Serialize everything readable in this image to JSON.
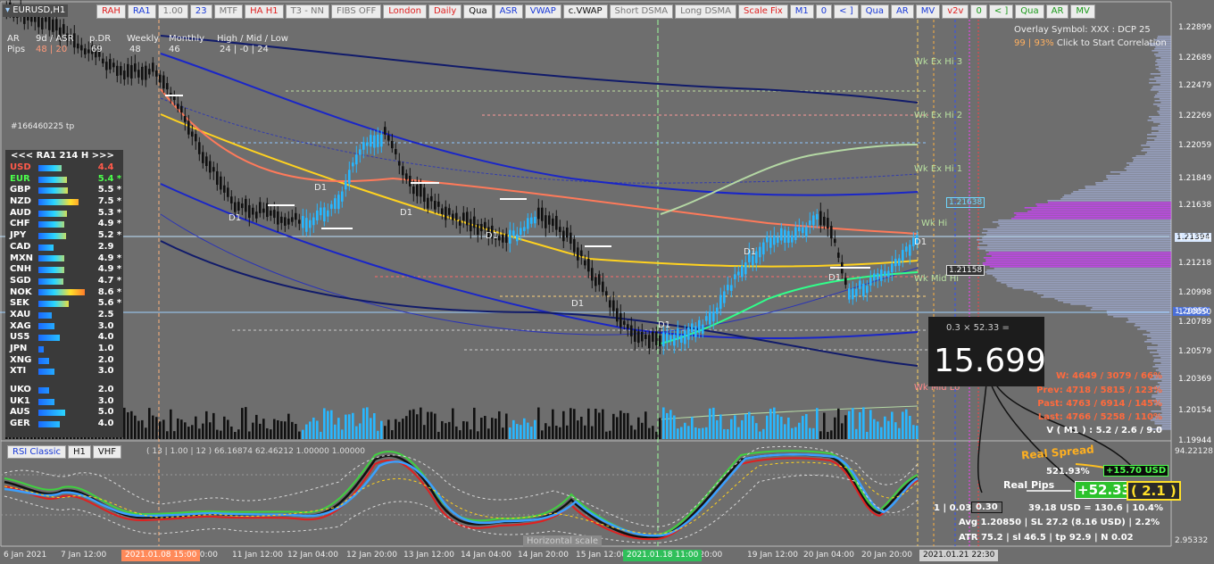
{
  "symbol": "EURUSD,H1",
  "toolbar": [
    "RAH",
    "RA1",
    "1.00",
    "23",
    "MTF",
    "HA H1",
    "T3 - NN",
    "FIBS OFF",
    "London",
    "Daily",
    "Qua",
    "ASR",
    "VWAP",
    "c.VWAP",
    "Short DSMA",
    "Long DSMA",
    "Scale Fix",
    "M1",
    "0",
    "< ]",
    "Qua",
    "AR",
    "MV",
    "v2v",
    "0",
    "< ]",
    "Qua",
    "AR",
    "MV"
  ],
  "toolbar_colors": [
    "#e02020",
    "#1a3ad8",
    "#777777",
    "#1a3ad8",
    "#777777",
    "#e02020",
    "#777777",
    "#777777",
    "#e02020",
    "#e02020",
    "#111111",
    "#1a3ad8",
    "#1a3ad8",
    "#111111",
    "#777777",
    "#777777",
    "#e02020",
    "#1a3ad8",
    "#1a3ad8",
    "#1a3ad8",
    "#1a3ad8",
    "#1a3ad8",
    "#1a3ad8",
    "#e02020",
    "#1a9a1a",
    "#1a9a1a",
    "#1a9a1a",
    "#1a9a1a",
    "#1a9a1a"
  ],
  "header_stats": {
    "ar_label": "AR",
    "pips_label": "Pips",
    "col_9d": "9d / ASR",
    "col_pdr": "p.DR",
    "col_weekly": "Weekly",
    "col_monthly": "Monthly",
    "col_hml": "High / Mid / Low",
    "val_9d": "48 | 20",
    "val_pdr": "69",
    "val_weekly": "48",
    "val_monthly": "46",
    "val_hml": "24 | -0 | 24"
  },
  "order_ref": "#166460225 tp",
  "overlay": {
    "line1": "Overlay Symbol: XXX : DCP 25",
    "line2_pct": "99 | 93%",
    "line2_text": " Click to Start Correlation"
  },
  "strength_panel": {
    "header": "<<<   RA1  214  H   >>>",
    "rows": [
      {
        "sym": "USD",
        "val": "4.4",
        "color": "#ff5a4a",
        "pct": 0.44
      },
      {
        "sym": "EUR",
        "val": "5.4 *",
        "color": "#4cff4c",
        "pct": 0.54
      },
      {
        "sym": "GBP",
        "val": "5.5 *",
        "color": "#ffffff",
        "pct": 0.55
      },
      {
        "sym": "NZD",
        "val": "7.5 *",
        "color": "#ffffff",
        "pct": 0.75
      },
      {
        "sym": "AUD",
        "val": "5.3 *",
        "color": "#ffffff",
        "pct": 0.53
      },
      {
        "sym": "CHF",
        "val": "4.9 *",
        "color": "#ffffff",
        "pct": 0.49
      },
      {
        "sym": "JPY",
        "val": "5.2 *",
        "color": "#ffffff",
        "pct": 0.52
      },
      {
        "sym": "CAD",
        "val": "2.9",
        "color": "#ffffff",
        "pct": 0.29
      },
      {
        "sym": "MXN",
        "val": "4.9 *",
        "color": "#ffffff",
        "pct": 0.49
      },
      {
        "sym": "CNH",
        "val": "4.9 *",
        "color": "#ffffff",
        "pct": 0.49
      },
      {
        "sym": "SGD",
        "val": "4.7 *",
        "color": "#ffffff",
        "pct": 0.47
      },
      {
        "sym": "NOK",
        "val": "8.6 *",
        "color": "#ffffff",
        "pct": 0.86
      },
      {
        "sym": "SEK",
        "val": "5.6 *",
        "color": "#ffffff",
        "pct": 0.56
      },
      {
        "sym": "XAU",
        "val": "2.5",
        "color": "#ffffff",
        "pct": 0.25
      },
      {
        "sym": "XAG",
        "val": "3.0",
        "color": "#ffffff",
        "pct": 0.3
      },
      {
        "sym": "US5",
        "val": "4.0",
        "color": "#ffffff",
        "pct": 0.4
      },
      {
        "sym": "JPN",
        "val": "1.0",
        "color": "#ffffff",
        "pct": 0.1
      },
      {
        "sym": "XNG",
        "val": "2.0",
        "color": "#ffffff",
        "pct": 0.2
      },
      {
        "sym": "XTI",
        "val": "3.0",
        "color": "#ffffff",
        "pct": 0.3
      },
      {
        "sym": "UKO",
        "val": "2.0",
        "color": "#ffffff",
        "pct": 0.2
      },
      {
        "sym": "UK1",
        "val": "3.0",
        "color": "#ffffff",
        "pct": 0.3
      },
      {
        "sym": "AUS",
        "val": "5.0",
        "color": "#ffffff",
        "pct": 0.5
      },
      {
        "sym": "GER",
        "val": "4.0",
        "color": "#ffffff",
        "pct": 0.4
      }
    ]
  },
  "price_axis": [
    "1.22899",
    "1.22689",
    "1.22479",
    "1.22269",
    "1.22059",
    "1.21849",
    "1.21638",
    "1.21394",
    "1.21218",
    "1.20998",
    "1.20850",
    "1.20789",
    "1.20579",
    "1.20369",
    "1.20154",
    "1.19944"
  ],
  "price_tags": {
    "p1": "1.21638",
    "p2": "1.21394",
    "p3": "1.21158",
    "p4": "1.20850"
  },
  "level_labels": [
    "Wk Ex Hi 3",
    "Wk Ex Hi 2",
    "Wk Ex Hi 1",
    "Wk Hi",
    "Wk Mid Hi",
    "Wk Mid Lo"
  ],
  "d1_labels": [
    "D1",
    "D1",
    "D1",
    "D1",
    "D1",
    "D1",
    "D1",
    "D1",
    "D1"
  ],
  "time_axis": [
    "6 Jan 2021",
    "7 Jan 12:00",
    "8 Jan 2021",
    "20:00",
    "11 Jan 12:00",
    "12 Jan 04:00",
    "12 Jan 20:00",
    "13 Jan 12:00",
    "14 Jan 04:00",
    "14 Jan 20:00",
    "15 Jan 12:00",
    "8 Jan 20:00",
    "19 Jan 12:00",
    "20 Jan 04:00",
    "20 Jan 20:00"
  ],
  "time_boxes": {
    "box1": "2021.01.08 15:00",
    "box2": "2021.01.18 11:00",
    "box3": "2021.01.21 22:30"
  },
  "horizontal_scale": "Horizontal scale",
  "calc": {
    "formula": "0.3 × 52.33 =",
    "value": "15.699"
  },
  "stats": {
    "w": "W: 4649 / 3079 / 66%",
    "prev": "Prev: 4718 / 5815 / 123%",
    "past": "Past: 4763 / 6914 / 145%",
    "last": "Last: 4766 / 5258 / 110%",
    "v": "V ( M1 ) : 5.2 / 2.6 / 9.0"
  },
  "real_spread": {
    "label": "Real Spread",
    "pct": "521.93%",
    "usd": "+15.70 USD"
  },
  "real_pips": {
    "label": "Real Pips",
    "value": "+52.33",
    "ratio": "( 2.1 )"
  },
  "trade_line": {
    "lots": "1  |  0.03",
    "box": "0.30",
    "usd": "39.18 USD = 130.6  |  10.4%"
  },
  "avg_line": "Avg 1.20850  |  SL 27.2 (8.16 USD)  |  2.2%",
  "atr_line": "ATR 75.2  |  sl 46.5  |  tp 92.9  |  N 0.02",
  "rsi": {
    "buttons": [
      "RSI Classic",
      "H1",
      "VHF"
    ],
    "params": "( 13 | 1.00 | 12 ) 66.16874 62.46212 1.00000 1.00000",
    "axis_top": "94.22128",
    "axis_bottom": "2.95332"
  }
}
